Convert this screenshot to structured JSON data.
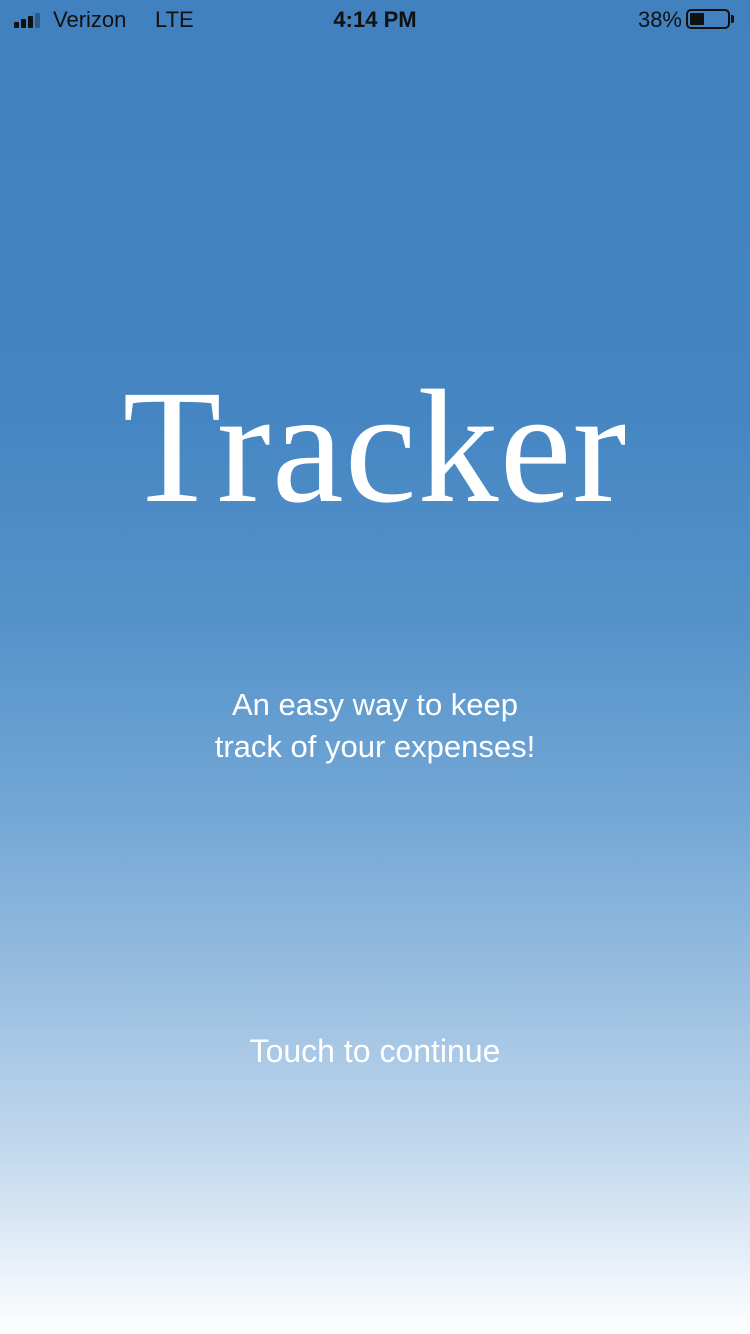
{
  "status_bar": {
    "carrier": "Verizon",
    "network": "LTE",
    "time": "4:14 PM",
    "battery_percent": "38%",
    "battery_level": 0.38,
    "signal_bars": 3,
    "signal_icon": "cellular-signal-icon",
    "battery_icon": "battery-icon"
  },
  "splash": {
    "title": "Tracker",
    "tagline_line1": "An easy way to keep",
    "tagline_line2": "track of your expenses!",
    "continue_label": "Touch to continue"
  },
  "colors": {
    "background_top": "#4181c0",
    "background_bottom": "#ffffff",
    "text": "#ffffff"
  }
}
